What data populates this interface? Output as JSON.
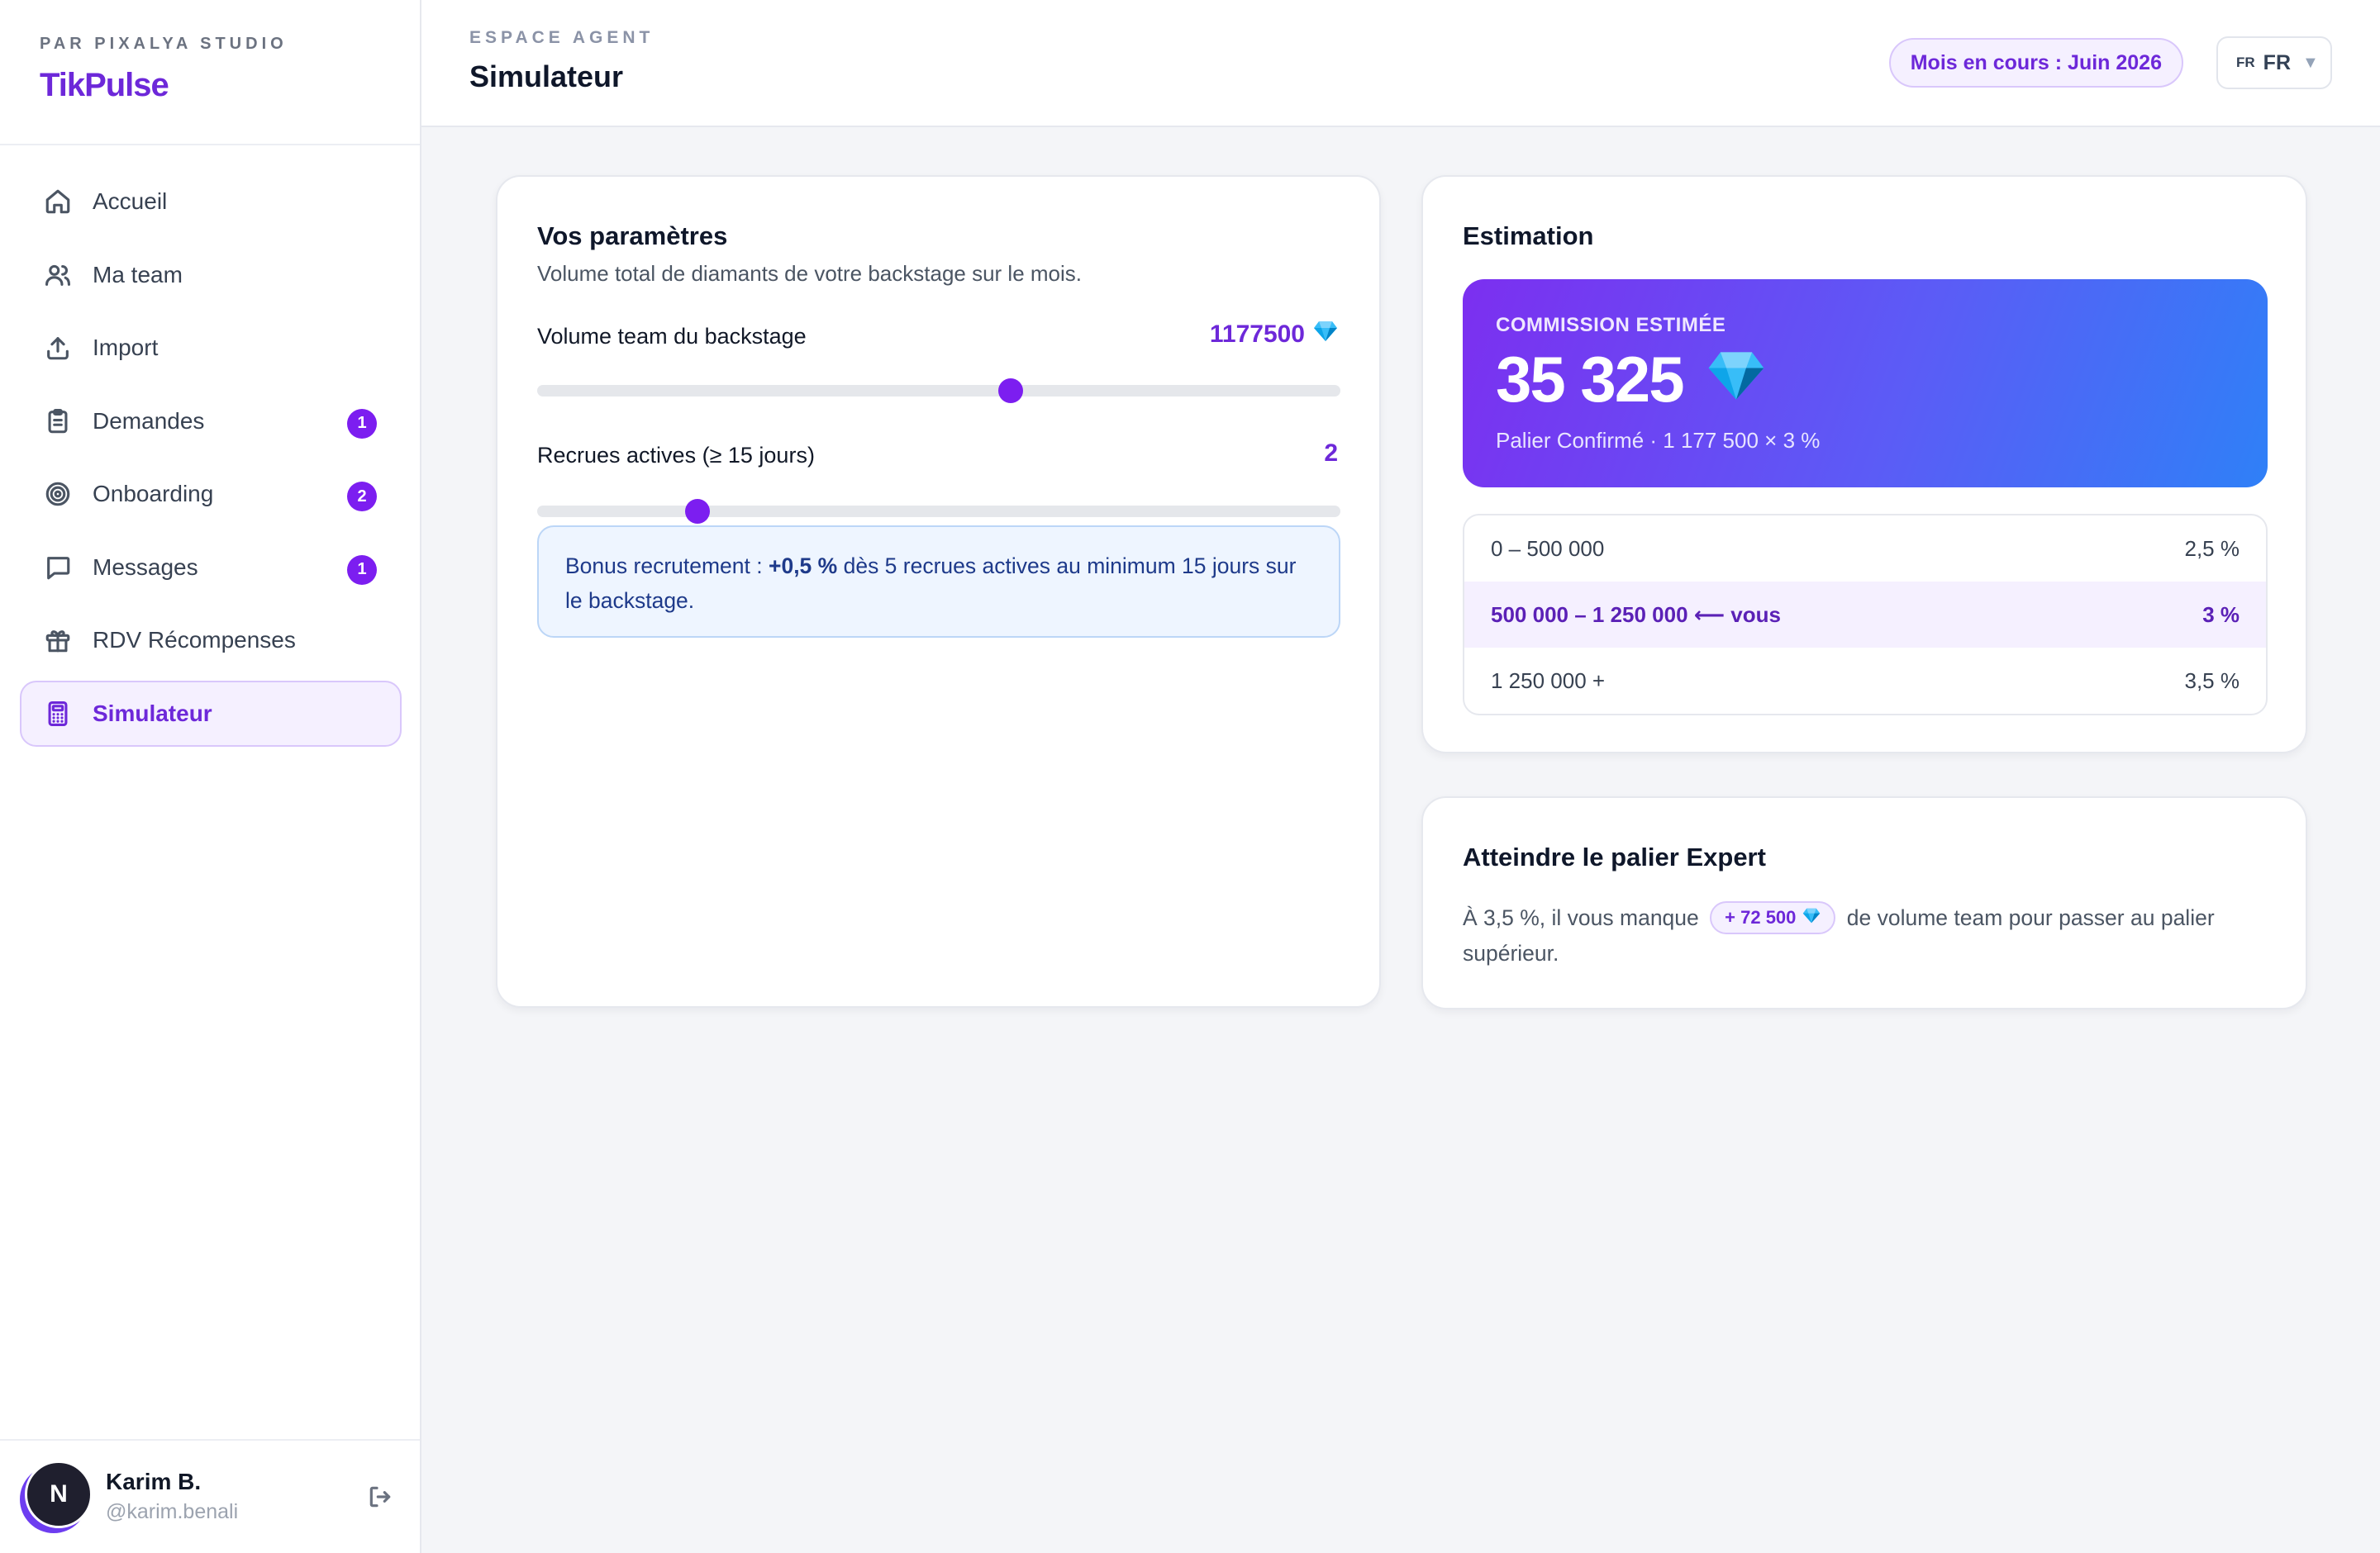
{
  "brand": {
    "subtitle": "PAR PIXALYA STUDIO",
    "name": "TikPulse"
  },
  "nav": [
    {
      "label": "Accueil",
      "icon": "home-icon",
      "badge": ""
    },
    {
      "label": "Ma team",
      "icon": "users-icon",
      "badge": ""
    },
    {
      "label": "Import",
      "icon": "upload-icon",
      "badge": ""
    },
    {
      "label": "Demandes",
      "icon": "clipboard-icon",
      "badge": "1"
    },
    {
      "label": "Onboarding",
      "icon": "target-icon",
      "badge": "2"
    },
    {
      "label": "Messages",
      "icon": "message-icon",
      "badge": "1"
    },
    {
      "label": "RDV Récompenses",
      "icon": "gift-icon",
      "badge": ""
    },
    {
      "label": "Simulateur",
      "icon": "calculator-icon",
      "badge": "",
      "active": true
    }
  ],
  "user": {
    "initial": "N",
    "name": "Karim B.",
    "handle": "@karim.benali"
  },
  "header": {
    "eyebrow": "ESPACE AGENT",
    "title": "Simulateur",
    "month": "Mois en cours : Juin 2026",
    "lang_flag": "FR",
    "lang_code": "FR"
  },
  "params": {
    "title": "Vos paramètres",
    "subtitle": "Volume total de diamants de votre backstage sur le mois.",
    "volume_label": "Volume team du backstage",
    "volume_value": "1177500",
    "volume_fraction": 0.589,
    "recruits_label": "Recrues actives (≥ 15 jours)",
    "recruits_value": "2",
    "recruits_fraction": 0.2,
    "bonus_prefix": "Bonus recrutement : ",
    "bonus_highlight": "+0,5 %",
    "bonus_suffix": " dès 5 recrues actives au minimum 15 jours sur le backstage."
  },
  "estimation": {
    "title": "Estimation",
    "hero_label": "COMMISSION ESTIMÉE",
    "hero_value": "35 325",
    "hero_formula": "Palier Confirmé · 1 177 500 × 3 %",
    "tiers": [
      {
        "range": "0 – 500 000",
        "rate": "2,5 %",
        "current": false
      },
      {
        "range": "500 000 – 1 250 000 ⟵ vous",
        "rate": "3 %",
        "current": true
      },
      {
        "range": "1 250 000 +",
        "rate": "3,5 %",
        "current": false
      }
    ]
  },
  "expert": {
    "title": "Atteindre le palier Expert",
    "text_before": "À 3,5 %, il vous manque",
    "gain": "+ 72 500",
    "text_after": "de volume team pour passer au palier supérieur."
  },
  "colors": {
    "accent": "#7c1ef0",
    "accent_soft": "#f5f0ff",
    "info_bg": "#eef5ff"
  }
}
